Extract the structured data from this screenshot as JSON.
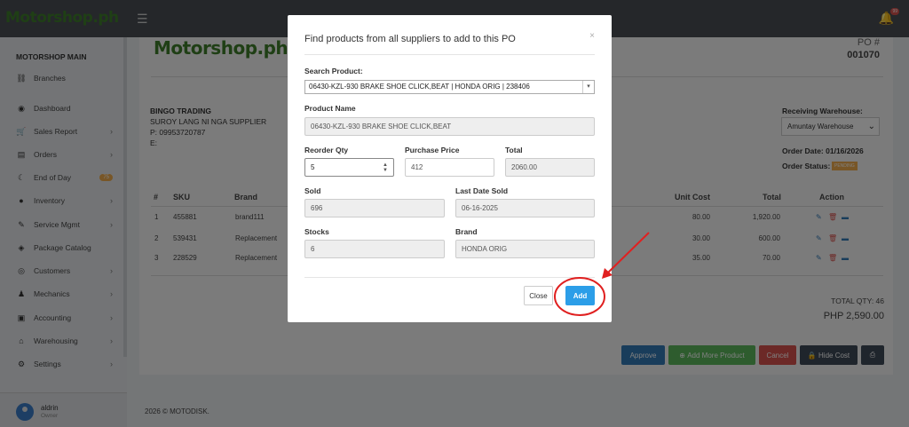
{
  "topbar": {
    "logo": "Motorshop.ph",
    "menu_icon": "hamburger-icon",
    "notif_count": "99"
  },
  "sidebar": {
    "heading": "MOTORSHOP MAIN",
    "items": [
      {
        "label": "Branches",
        "icon": "sitemap-icon",
        "glyph": "⛓"
      },
      {
        "label": "Dashboard",
        "icon": "palette-icon",
        "glyph": "◉"
      },
      {
        "label": "Sales Report",
        "icon": "cart-icon",
        "glyph": "🛒",
        "chev": true
      },
      {
        "label": "Orders",
        "icon": "copy-icon",
        "glyph": "▤",
        "chev": true
      },
      {
        "label": "End of Day",
        "icon": "moon-icon",
        "glyph": "☾",
        "badge": "75"
      },
      {
        "label": "Inventory",
        "icon": "product-icon",
        "glyph": "●",
        "chev": true
      },
      {
        "label": "Service Mgmt",
        "icon": "wrench-icon",
        "glyph": "✎",
        "chev": true
      },
      {
        "label": "Package Catalog",
        "icon": "box-icon",
        "glyph": "◈"
      },
      {
        "label": "Customers",
        "icon": "user-icon",
        "glyph": "◎",
        "chev": true
      },
      {
        "label": "Mechanics",
        "icon": "users-icon",
        "glyph": "♟",
        "chev": true
      },
      {
        "label": "Accounting",
        "icon": "money-icon",
        "glyph": "▣",
        "chev": true
      },
      {
        "label": "Warehousing",
        "icon": "warehouse-icon",
        "glyph": "⌂",
        "chev": true
      },
      {
        "label": "Settings",
        "icon": "cogs-icon",
        "glyph": "⚙",
        "chev": true
      }
    ],
    "user": {
      "name": "aldrin",
      "role": "Owner"
    }
  },
  "po": {
    "logo": "Motorshop.ph",
    "po_label": "PO #",
    "po_number": "001070",
    "supplier": {
      "name": "BINGO TRADING",
      "subtitle": "SUROY LANG NI NGA SUPPLIER",
      "phone": "P: 09953720787",
      "email": "E:"
    },
    "receiving_warehouse_label": "Receiving Warehouse:",
    "receiving_warehouse": "Amuntay Warehouse",
    "order_date": "Order Date: 01/16/2026",
    "order_status_label": "Order Status:",
    "order_status": "PENDING",
    "columns": {
      "num": "#",
      "sku": "SKU",
      "brand": "Brand",
      "unit_cost": "Unit Cost",
      "total": "Total",
      "action": "Action"
    },
    "rows": [
      {
        "num": "1",
        "sku": "455881",
        "brand": "brand111",
        "unit_cost": "80.00",
        "total": "1,920.00"
      },
      {
        "num": "2",
        "sku": "539431",
        "brand": "Replacement",
        "unit_cost": "30.00",
        "total": "600.00"
      },
      {
        "num": "3",
        "sku": "228529",
        "brand": "Replacement",
        "unit_cost": "35.00",
        "total": "70.00"
      }
    ],
    "total_qty": "TOTAL QTY: 46",
    "total_amount": "PHP 2,590.00",
    "actions": {
      "approve": "Approve",
      "add_more": "Add More Product",
      "cancel": "Cancel",
      "hide_cost": "Hide Cost"
    }
  },
  "footer": "2026 © MOTODISK.",
  "modal": {
    "title": "Find products from all suppliers to add to this PO",
    "search_label": "Search Product:",
    "search_value": "06430-KZL-930 BRAKE SHOE CLICK,BEAT | HONDA ORIG | 238406",
    "product_name_label": "Product Name",
    "product_name": "06430-KZL-930 BRAKE SHOE CLICK,BEAT",
    "reorder_qty_label": "Reorder Qty",
    "reorder_qty": "5",
    "purchase_price_label": "Purchase Price",
    "purchase_price": "412",
    "total_label": "Total",
    "total": "2060.00",
    "sold_label": "Sold",
    "sold": "696",
    "last_date_sold_label": "Last Date Sold",
    "last_date_sold": "06-16-2025",
    "stocks_label": "Stocks",
    "stocks": "6",
    "brand_label": "Brand",
    "brand": "HONDA ORIG",
    "close_label": "Close",
    "add_label": "Add"
  },
  "colors": {
    "accent": "#2c9ee8",
    "annotation": "#e02020",
    "brand_green": "#3f7f2b"
  }
}
